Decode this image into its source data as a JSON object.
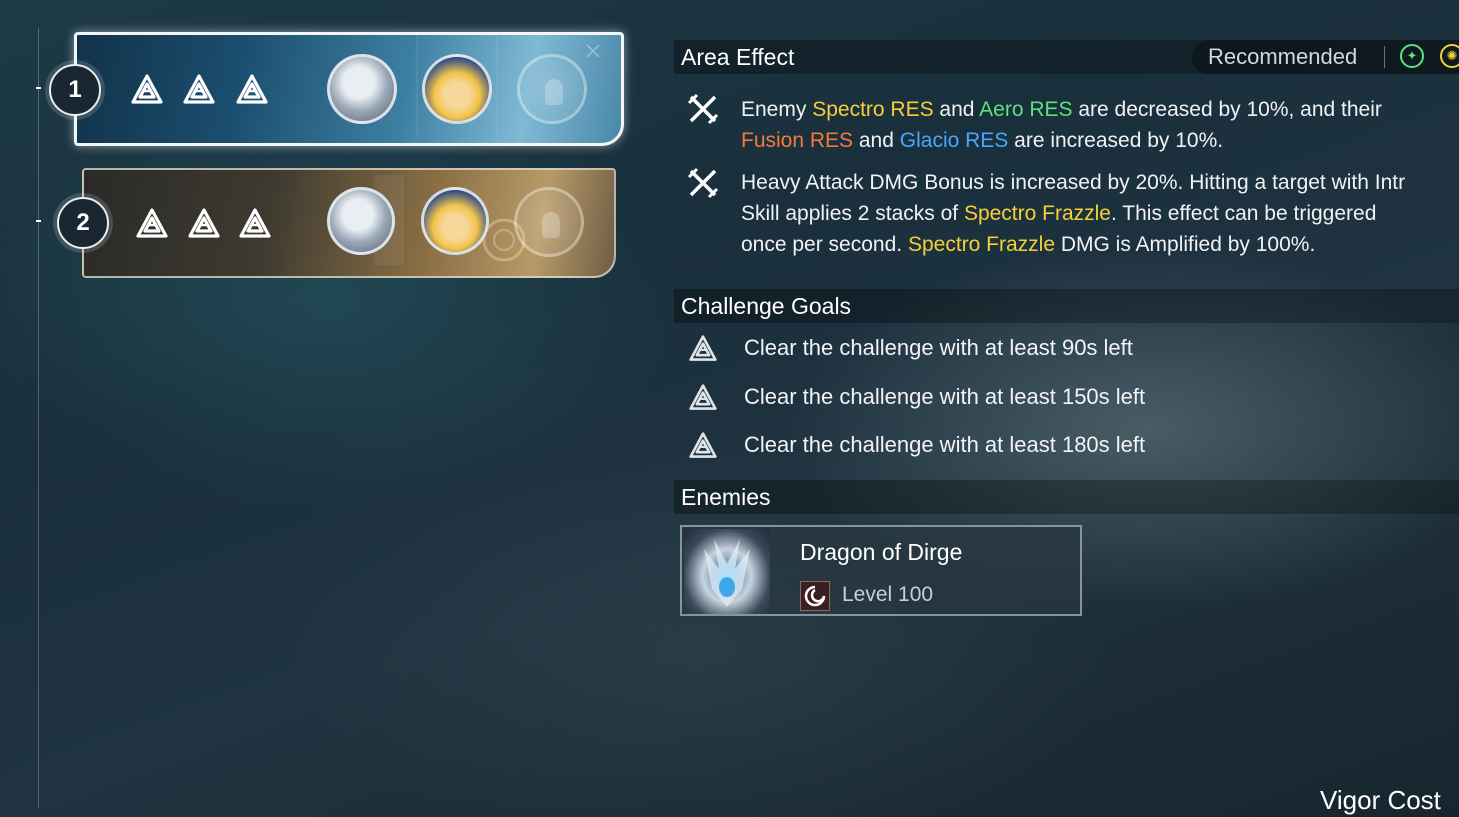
{
  "teams": [
    {
      "number": "1",
      "selected": true,
      "goals_cleared": 3,
      "members": [
        "silver-haired-character",
        "blonde-character",
        "empty-slot"
      ]
    },
    {
      "number": "2",
      "selected": false,
      "goals_cleared": 3,
      "members": [
        "silver-haired-character",
        "blonde-character",
        "empty-slot"
      ]
    }
  ],
  "area_effect": {
    "title": "Area Effect",
    "recommended_label": "Recommended",
    "effects": [
      {
        "icon": "crossed-swords-icon",
        "lines": [
          [
            {
              "text": "Enemy ",
              "color": "white"
            },
            {
              "text": "Spectro RES",
              "color": "yellow"
            },
            {
              "text": " and ",
              "color": "white"
            },
            {
              "text": "Aero RES",
              "color": "green"
            },
            {
              "text": " are decreased by 10%, and their",
              "color": "white"
            }
          ],
          [
            {
              "text": "Fusion RES",
              "color": "orange"
            },
            {
              "text": " and ",
              "color": "white"
            },
            {
              "text": "Glacio RES",
              "color": "blue"
            },
            {
              "text": " are increased by 10%.",
              "color": "white"
            }
          ]
        ]
      },
      {
        "icon": "crossed-swords-icon",
        "lines": [
          [
            {
              "text": "Heavy Attack DMG Bonus is increased by 20%. Hitting a target with Intr",
              "color": "white"
            }
          ],
          [
            {
              "text": "Skill applies 2 stacks of ",
              "color": "white"
            },
            {
              "text": "Spectro Frazzle",
              "color": "yellow"
            },
            {
              "text": ". This effect can be triggered",
              "color": "white"
            }
          ],
          [
            {
              "text": "once per second. ",
              "color": "white"
            },
            {
              "text": "Spectro Frazzle",
              "color": "yellow"
            },
            {
              "text": " DMG is Amplified by 100%.",
              "color": "white"
            }
          ]
        ]
      }
    ]
  },
  "challenge_goals": {
    "title": "Challenge Goals",
    "goals": [
      "Clear the challenge with at least 90s left",
      "Clear the challenge with at least 150s left",
      "Clear the challenge with at least 180s left"
    ]
  },
  "enemies": {
    "title": "Enemies",
    "list": [
      {
        "name": "Dragon of Dirge",
        "level": "Level 100"
      }
    ]
  },
  "footer": {
    "vigor_label": "Vigor Cost"
  },
  "colors": {
    "yellow": "#f5d036",
    "green": "#5fe07e",
    "orange": "#f07a3a",
    "blue": "#4aa6ff"
  }
}
